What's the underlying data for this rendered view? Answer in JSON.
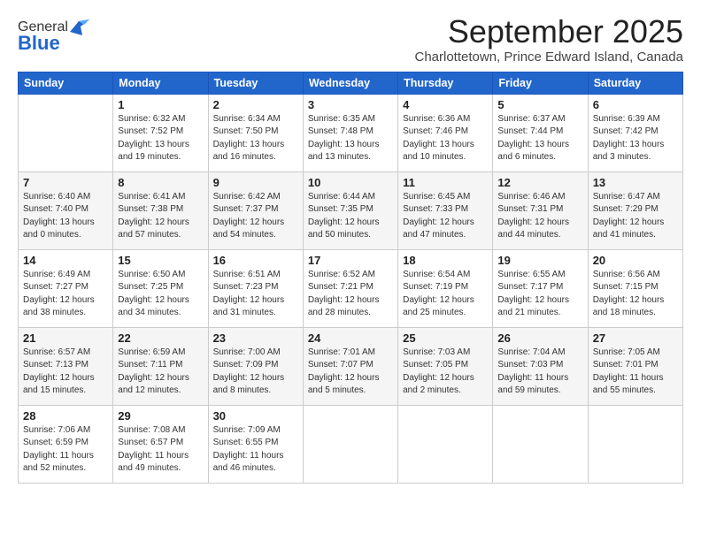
{
  "header": {
    "logo_general": "General",
    "logo_blue": "Blue",
    "month_title": "September 2025",
    "location": "Charlottetown, Prince Edward Island, Canada"
  },
  "weekdays": [
    "Sunday",
    "Monday",
    "Tuesday",
    "Wednesday",
    "Thursday",
    "Friday",
    "Saturday"
  ],
  "weeks": [
    [
      {
        "day": "",
        "info": ""
      },
      {
        "day": "1",
        "info": "Sunrise: 6:32 AM\nSunset: 7:52 PM\nDaylight: 13 hours\nand 19 minutes."
      },
      {
        "day": "2",
        "info": "Sunrise: 6:34 AM\nSunset: 7:50 PM\nDaylight: 13 hours\nand 16 minutes."
      },
      {
        "day": "3",
        "info": "Sunrise: 6:35 AM\nSunset: 7:48 PM\nDaylight: 13 hours\nand 13 minutes."
      },
      {
        "day": "4",
        "info": "Sunrise: 6:36 AM\nSunset: 7:46 PM\nDaylight: 13 hours\nand 10 minutes."
      },
      {
        "day": "5",
        "info": "Sunrise: 6:37 AM\nSunset: 7:44 PM\nDaylight: 13 hours\nand 6 minutes."
      },
      {
        "day": "6",
        "info": "Sunrise: 6:39 AM\nSunset: 7:42 PM\nDaylight: 13 hours\nand 3 minutes."
      }
    ],
    [
      {
        "day": "7",
        "info": "Sunrise: 6:40 AM\nSunset: 7:40 PM\nDaylight: 13 hours\nand 0 minutes."
      },
      {
        "day": "8",
        "info": "Sunrise: 6:41 AM\nSunset: 7:38 PM\nDaylight: 12 hours\nand 57 minutes."
      },
      {
        "day": "9",
        "info": "Sunrise: 6:42 AM\nSunset: 7:37 PM\nDaylight: 12 hours\nand 54 minutes."
      },
      {
        "day": "10",
        "info": "Sunrise: 6:44 AM\nSunset: 7:35 PM\nDaylight: 12 hours\nand 50 minutes."
      },
      {
        "day": "11",
        "info": "Sunrise: 6:45 AM\nSunset: 7:33 PM\nDaylight: 12 hours\nand 47 minutes."
      },
      {
        "day": "12",
        "info": "Sunrise: 6:46 AM\nSunset: 7:31 PM\nDaylight: 12 hours\nand 44 minutes."
      },
      {
        "day": "13",
        "info": "Sunrise: 6:47 AM\nSunset: 7:29 PM\nDaylight: 12 hours\nand 41 minutes."
      }
    ],
    [
      {
        "day": "14",
        "info": "Sunrise: 6:49 AM\nSunset: 7:27 PM\nDaylight: 12 hours\nand 38 minutes."
      },
      {
        "day": "15",
        "info": "Sunrise: 6:50 AM\nSunset: 7:25 PM\nDaylight: 12 hours\nand 34 minutes."
      },
      {
        "day": "16",
        "info": "Sunrise: 6:51 AM\nSunset: 7:23 PM\nDaylight: 12 hours\nand 31 minutes."
      },
      {
        "day": "17",
        "info": "Sunrise: 6:52 AM\nSunset: 7:21 PM\nDaylight: 12 hours\nand 28 minutes."
      },
      {
        "day": "18",
        "info": "Sunrise: 6:54 AM\nSunset: 7:19 PM\nDaylight: 12 hours\nand 25 minutes."
      },
      {
        "day": "19",
        "info": "Sunrise: 6:55 AM\nSunset: 7:17 PM\nDaylight: 12 hours\nand 21 minutes."
      },
      {
        "day": "20",
        "info": "Sunrise: 6:56 AM\nSunset: 7:15 PM\nDaylight: 12 hours\nand 18 minutes."
      }
    ],
    [
      {
        "day": "21",
        "info": "Sunrise: 6:57 AM\nSunset: 7:13 PM\nDaylight: 12 hours\nand 15 minutes."
      },
      {
        "day": "22",
        "info": "Sunrise: 6:59 AM\nSunset: 7:11 PM\nDaylight: 12 hours\nand 12 minutes."
      },
      {
        "day": "23",
        "info": "Sunrise: 7:00 AM\nSunset: 7:09 PM\nDaylight: 12 hours\nand 8 minutes."
      },
      {
        "day": "24",
        "info": "Sunrise: 7:01 AM\nSunset: 7:07 PM\nDaylight: 12 hours\nand 5 minutes."
      },
      {
        "day": "25",
        "info": "Sunrise: 7:03 AM\nSunset: 7:05 PM\nDaylight: 12 hours\nand 2 minutes."
      },
      {
        "day": "26",
        "info": "Sunrise: 7:04 AM\nSunset: 7:03 PM\nDaylight: 11 hours\nand 59 minutes."
      },
      {
        "day": "27",
        "info": "Sunrise: 7:05 AM\nSunset: 7:01 PM\nDaylight: 11 hours\nand 55 minutes."
      }
    ],
    [
      {
        "day": "28",
        "info": "Sunrise: 7:06 AM\nSunset: 6:59 PM\nDaylight: 11 hours\nand 52 minutes."
      },
      {
        "day": "29",
        "info": "Sunrise: 7:08 AM\nSunset: 6:57 PM\nDaylight: 11 hours\nand 49 minutes."
      },
      {
        "day": "30",
        "info": "Sunrise: 7:09 AM\nSunset: 6:55 PM\nDaylight: 11 hours\nand 46 minutes."
      },
      {
        "day": "",
        "info": ""
      },
      {
        "day": "",
        "info": ""
      },
      {
        "day": "",
        "info": ""
      },
      {
        "day": "",
        "info": ""
      }
    ]
  ]
}
